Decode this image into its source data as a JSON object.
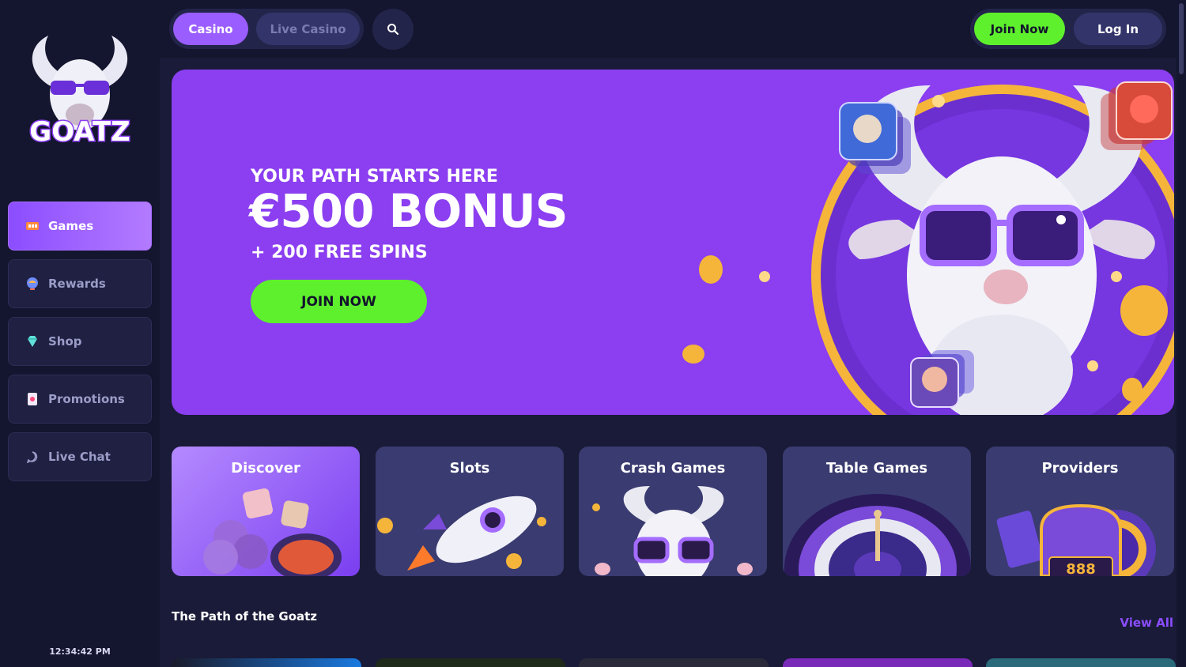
{
  "brand": {
    "name": "GOATZ"
  },
  "sidebar": {
    "items": [
      {
        "label": "Games",
        "icon": "slot-machine-icon",
        "active": true
      },
      {
        "label": "Rewards",
        "icon": "globe-icon",
        "active": false
      },
      {
        "label": "Shop",
        "icon": "gem-icon",
        "active": false
      },
      {
        "label": "Promotions",
        "icon": "card-icon",
        "active": false
      },
      {
        "label": "Live Chat",
        "icon": "chat-icon",
        "active": false
      }
    ],
    "clock": "12:34:42 PM"
  },
  "header": {
    "tabs": [
      {
        "label": "Casino",
        "active": true
      },
      {
        "label": "Live Casino",
        "active": false
      }
    ],
    "join_label": "Join Now",
    "login_label": "Log In"
  },
  "hero": {
    "subtitle": "YOUR PATH STARTS HERE",
    "title": "€500 BONUS",
    "spins": "+ 200 FREE SPINS",
    "cta": "JOIN NOW"
  },
  "categories": [
    {
      "label": "Discover"
    },
    {
      "label": "Slots"
    },
    {
      "label": "Crash Games"
    },
    {
      "label": "Table Games"
    },
    {
      "label": "Providers"
    }
  ],
  "section": {
    "title": "The Path of the Goatz",
    "view_all": "View All"
  },
  "colors": {
    "accent": "#8b4dff",
    "cta_green": "#5ef02c",
    "hero_bg": "#8b3ff0",
    "page_bg": "#1a1b38"
  }
}
